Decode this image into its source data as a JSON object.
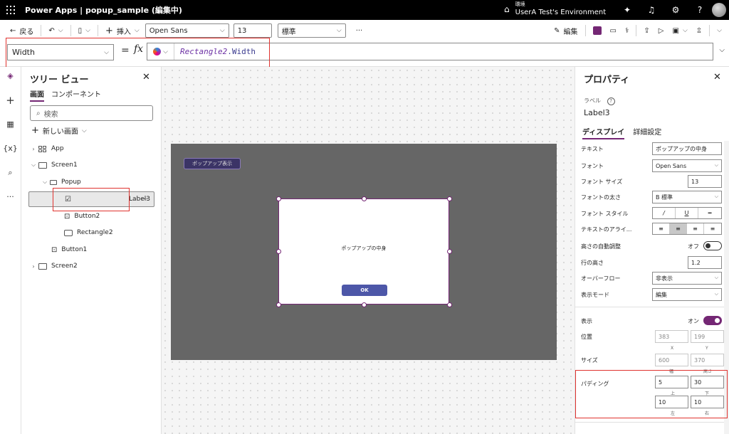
{
  "topbar": {
    "title": "Power Apps  |  popup_sample (編集中)",
    "env_label": "環境",
    "env_value": "UserA Test's Environment"
  },
  "cmdbar": {
    "back": "戻る",
    "insert": "挿入",
    "font": "Open Sans",
    "font_size": "13",
    "weight": "標準",
    "more": "···",
    "edit": "編集"
  },
  "formula": {
    "property": "Width",
    "expr_object": "Rectangle2",
    "expr_prop": ".Width"
  },
  "tree": {
    "title": "ツリー ビュー",
    "tabs": [
      "画面",
      "コンポーネント"
    ],
    "search_placeholder": "検索",
    "new_screen": "新しい画面",
    "nodes": [
      "App",
      "Screen1",
      "Popup",
      "Label3",
      "Button2",
      "Rectangle2",
      "Button1",
      "Screen2"
    ]
  },
  "canvas": {
    "popup_button": "ポップアップ表示",
    "label_text": "ポップアップの中身",
    "ok": "OK"
  },
  "props": {
    "title": "プロパティ",
    "type_label": "ラベル",
    "name": "Label3",
    "tabs": [
      "ディスプレイ",
      "詳細設定"
    ],
    "rows": {
      "text_label": "テキスト",
      "text_value": "ポップアップの中身",
      "font_label": "フォント",
      "font_value": "Open Sans",
      "size_label": "フォント サイズ",
      "size_value": "13",
      "weight_label": "フォントの太さ",
      "weight_value": "B  標準",
      "style_label": "フォント スタイル",
      "align_label": "テキストのアライ...",
      "autoheight_label": "高さの自動調整",
      "autoheight_state": "オフ",
      "lineheight_label": "行の高さ",
      "lineheight_value": "1.2",
      "overflow_label": "オーバーフロー",
      "overflow_value": "非表示",
      "mode_label": "表示モード",
      "mode_value": "編集",
      "visible_label": "表示",
      "visible_state": "オン",
      "position_label": "位置",
      "pos_x": "383",
      "pos_y": "199",
      "x_label": "X",
      "y_label": "Y",
      "size2_label": "サイズ",
      "width": "600",
      "height": "370",
      "w_label": "幅",
      "h_label": "高さ",
      "padding_label": "パディング",
      "pad_top": "5",
      "pad_bottom": "30",
      "pad_left": "10",
      "pad_right": "10",
      "top_label": "上",
      "bottom_label": "下",
      "left_label": "左",
      "right_label": "右"
    }
  }
}
